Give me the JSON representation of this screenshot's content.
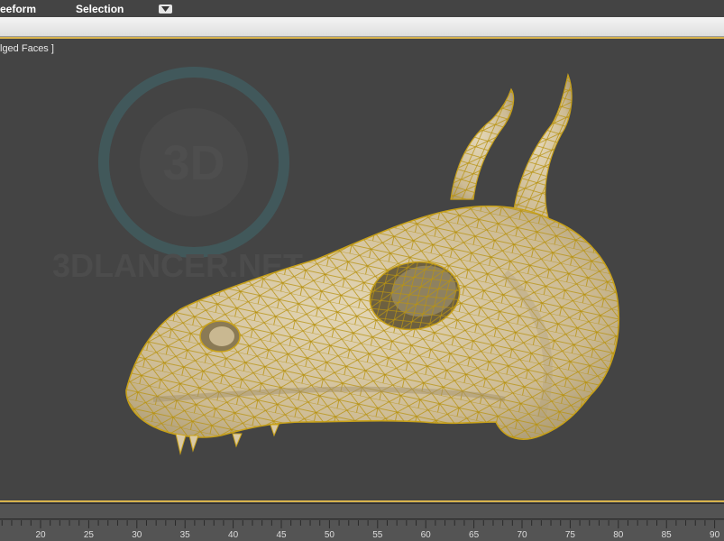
{
  "ribbon": {
    "tabs": [
      {
        "label": "eeform"
      },
      {
        "label": "Selection"
      }
    ],
    "dropdown_icon": "chevron-down-icon"
  },
  "viewport": {
    "label": "lged Faces ]",
    "watermark": "3DLANCER.NET",
    "watermark_logo": "3D",
    "model": "dragon-skull-wireframe",
    "border_color": "#d8b34d",
    "model_color": "#d9c9a6",
    "wire_color": "#b89312"
  },
  "trackbar": {
    "labels": [
      "20",
      "25",
      "30",
      "35",
      "40",
      "45",
      "50",
      "55",
      "60",
      "65",
      "70",
      "75",
      "80",
      "85",
      "90"
    ]
  }
}
